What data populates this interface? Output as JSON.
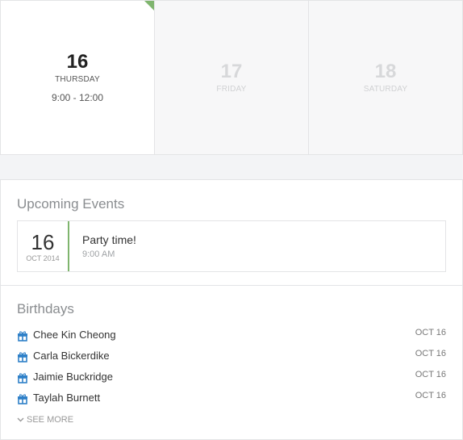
{
  "days": [
    {
      "number": "16",
      "weekday": "THURSDAY",
      "time": "9:00 - 12:00",
      "active": true
    },
    {
      "number": "17",
      "weekday": "FRIDAY",
      "time": "",
      "active": false
    },
    {
      "number": "18",
      "weekday": "SATURDAY",
      "time": "",
      "active": false
    }
  ],
  "upcoming": {
    "title": "Upcoming Events",
    "event": {
      "day": "16",
      "month_year": "OCT 2014",
      "title": "Party time!",
      "time": "9:00 AM"
    }
  },
  "birthdays": {
    "title": "Birthdays",
    "icon": "gift-icon",
    "items": [
      {
        "name": "Chee Kin Cheong",
        "date": "OCT 16"
      },
      {
        "name": "Carla Bickerdike",
        "date": "OCT 16"
      },
      {
        "name": "Jaimie Buckridge",
        "date": "OCT 16"
      },
      {
        "name": "Taylah Burnett",
        "date": "OCT 16"
      }
    ],
    "see_more": "SEE MORE"
  },
  "colors": {
    "accent": "#7fb56e",
    "icon": "#2f80c8"
  }
}
